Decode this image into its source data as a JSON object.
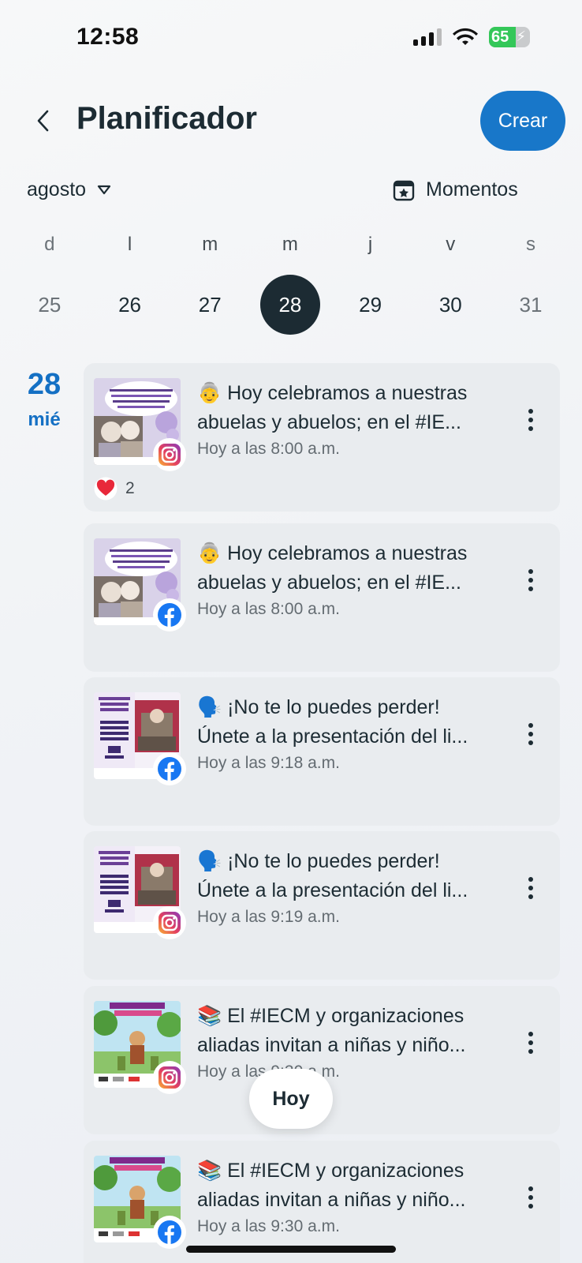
{
  "status_bar": {
    "time": "12:58",
    "battery": "65"
  },
  "header": {
    "title": "Planificador",
    "create_label": "Crear"
  },
  "filters": {
    "month": "agosto",
    "moments_label": "Momentos"
  },
  "week": {
    "weekdays": [
      "d",
      "l",
      "m",
      "m",
      "j",
      "v",
      "s"
    ],
    "dates": [
      "25",
      "26",
      "27",
      "28",
      "29",
      "30",
      "31"
    ],
    "selected": "28"
  },
  "day": {
    "number": "28",
    "name": "mié"
  },
  "posts": [
    {
      "emoji": "👵",
      "line1": "Hoy celebramos a nuestras",
      "line2": "abuelas y abuelos; en el #IE...",
      "time": "Hoy a las 8:00 a.m.",
      "network": "instagram",
      "thumb": "abuelos",
      "reaction_count": "2"
    },
    {
      "emoji": "👵",
      "line1": "Hoy celebramos a nuestras",
      "line2": "abuelas y abuelos; en el #IE...",
      "time": "Hoy a las 8:00 a.m.",
      "network": "facebook",
      "thumb": "abuelos"
    },
    {
      "emoji": "🗣️",
      "line1": "¡No te lo puedes perder!",
      "line2": "Únete a la presentación del li...",
      "time": "Hoy a las 9:18 a.m.",
      "network": "facebook",
      "thumb": "libro"
    },
    {
      "emoji": "🗣️",
      "line1": "¡No te lo puedes perder!",
      "line2": "Únete a la presentación del li...",
      "time": "Hoy a las 9:19 a.m.",
      "network": "instagram",
      "thumb": "libro"
    },
    {
      "emoji": "📚",
      "line1": "El #IECM y organizaciones",
      "line2": "aliadas invitan a niñas y niño...",
      "time": "Hoy a las 9:30 a.m.",
      "network": "instagram",
      "thumb": "cuento"
    },
    {
      "emoji": "📚",
      "line1": "El #IECM y organizaciones",
      "line2": "aliadas invitan a niñas y niño...",
      "time": "Hoy a las 9:30 a.m.",
      "network": "facebook",
      "thumb": "cuento"
    }
  ],
  "today_button": "Hoy",
  "colors": {
    "accent": "#1877c9",
    "day_label": "#1470c4",
    "selected_day": "#1c2b33",
    "card_bg": "#e9ecef"
  },
  "icons": [
    "back-chevron-icon",
    "dropdown-triangle-icon",
    "calendar-star-icon",
    "instagram-icon",
    "facebook-icon",
    "more-vertical-icon",
    "heart-icon"
  ]
}
